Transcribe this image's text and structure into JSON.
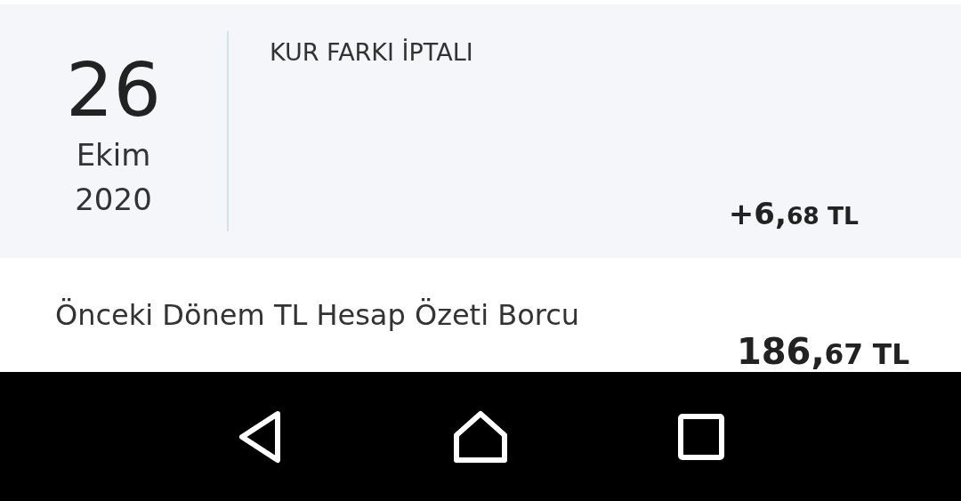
{
  "transaction": {
    "day": "26",
    "month": "Ekim",
    "year": "2020",
    "title": "KUR FARKI İPTALI",
    "amount": {
      "whole": "+6,",
      "fraction": "68 TL"
    }
  },
  "summary": {
    "label": "Önceki Dönem TL Hesap Özeti Borcu",
    "amount": {
      "whole": "186,",
      "fraction": "67 TL"
    }
  },
  "nav_bar": {
    "buttons": [
      {
        "kind": "back"
      },
      {
        "kind": "home"
      },
      {
        "kind": "recents"
      }
    ]
  }
}
